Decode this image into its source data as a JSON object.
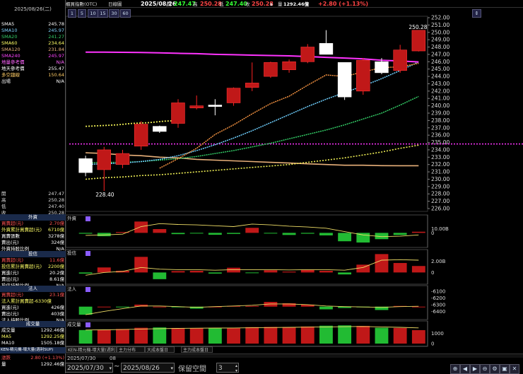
{
  "header": {
    "index_name": "櫃買指數(OTC)",
    "period": "日線圖",
    "date": "2025/08/26",
    "open_label": "開",
    "open": "247.47",
    "high_label": "高",
    "high": "250.28",
    "low_label": "低",
    "low": "247.40",
    "close_label": "收",
    "close": "250.28",
    "close_mark": "s",
    "volume_label": "量",
    "volume": "1292.46億",
    "change": "+2.80 (+1.13%)"
  },
  "toolbar": {
    "periods": [
      "1",
      "5",
      "10",
      "15",
      "30",
      "60"
    ]
  },
  "left": {
    "date": "2025/08/26(二)",
    "ma_rows": [
      {
        "k": "SMA5",
        "v": "245.78",
        "c": "#ffffff"
      },
      {
        "k": "SMA10",
        "v": "245.97",
        "c": "#7fd4ff"
      },
      {
        "k": "SMA20",
        "v": "241.27",
        "c": "#33cc66"
      },
      {
        "k": "SMA60",
        "v": "234.64",
        "c": "#ffff66"
      },
      {
        "k": "SMA120",
        "v": "231.84",
        "c": "#e8b07a"
      },
      {
        "k": "SMA240",
        "v": "245.97",
        "c": "#ff44ff"
      },
      {
        "k": "地量參考價",
        "v": "N/A",
        "c": "#ff66ff"
      },
      {
        "k": "地天參考價",
        "v": "255.47",
        "c": "#ffffff"
      },
      {
        "k": "多空趨線",
        "v": "150.64",
        "c": "#ffcc66"
      },
      {
        "k": "出場",
        "v": "N/A",
        "c": "#ffffff"
      }
    ],
    "ohlc_rows": [
      {
        "k": "開",
        "v": "247.47"
      },
      {
        "k": "高",
        "v": "250.28"
      },
      {
        "k": "低",
        "v": "247.40"
      },
      {
        "k": "收",
        "v": "250.28"
      }
    ],
    "foreign_title": "外資",
    "foreign_rows": [
      {
        "k": "買賣超(元)",
        "v": "2.70億",
        "c": "#ff5555"
      },
      {
        "k": "外資累計買賣超(元)",
        "v": "6710億",
        "c": "#ffff66"
      },
      {
        "k": "買賣張數",
        "v": "3278億",
        "c": "#ffffff"
      },
      {
        "k": "賣出(元)",
        "v": "324億",
        "c": "#ffffff"
      },
      {
        "k": "外資持股比例",
        "v": "N/A",
        "c": "#ffffff"
      }
    ],
    "trust_title": "投信",
    "trust_rows": [
      {
        "k": "買賣超(元)",
        "v": "11.6億",
        "c": "#ff5555"
      },
      {
        "k": "投信累計買賣超(元)",
        "v": "2200億",
        "c": "#ffff66"
      },
      {
        "k": "買進(元)",
        "v": "20.2億",
        "c": "#ffffff"
      },
      {
        "k": "賣出(元)",
        "v": "8.61億",
        "c": "#ffffff"
      },
      {
        "k": "投信持股比例",
        "v": "N/A",
        "c": "#ffffff"
      }
    ],
    "inst_title": "法人",
    "inst_rows": [
      {
        "k": "買賣超(元)",
        "v": "23.1億",
        "c": "#ff5555"
      },
      {
        "k": "法人累計買賣超-6330億",
        "v": "",
        "c": "#ffff66"
      },
      {
        "k": "買進(元)",
        "v": "426億",
        "c": "#ffffff"
      },
      {
        "k": "賣出(元)",
        "v": "403億",
        "c": "#ffffff"
      },
      {
        "k": "法人持股比例",
        "v": "N/A",
        "c": "#ffffff"
      }
    ],
    "vol_title": "成交量",
    "vol_rows": [
      {
        "k": "成交量",
        "v": "1292.46億",
        "c": "#ffffff"
      },
      {
        "k": "MA5",
        "v": "1292.25億",
        "c": "#ffff66"
      },
      {
        "k": "MA10",
        "v": "1505.18億",
        "c": "#ffffff"
      }
    ],
    "bottom_title": "KEN-精元機-壞大量(週利SUP)",
    "bottom_rows": [
      {
        "k": "漲跌",
        "v": "2.80 (+1.13%)",
        "c": "#ff5555"
      },
      {
        "k": "量",
        "v": "1292.46億",
        "c": "#ffffff"
      }
    ]
  },
  "bottom": {
    "tabs": [
      "KEN-精元機-壞大量(週利SUP)",
      "主力分布",
      "大成本盤日",
      "主力成本盤日"
    ],
    "start_date": "2025/07/30",
    "start_cursor_label": "08",
    "tilde": "~",
    "end_date": "2025/08/26",
    "keep_label": "保留空間",
    "keep_value": "3"
  },
  "panels": {
    "foreign": "外資",
    "trust": "投信",
    "inst": "法人",
    "volume": "成交量"
  },
  "annotations": {
    "high_marker": "250.28",
    "low_marker": "228.40"
  },
  "colors": {
    "up": "#c01818",
    "down": "#ffffff",
    "sma5": "#ffffff",
    "sma10": "#6fd0ff",
    "sma20": "#33cc66",
    "sma60": "#eeee55",
    "sma120": "#e8b07a",
    "sma240": "#ff33ff"
  },
  "chart_data": {
    "type": "candlestick",
    "price_axis": {
      "min": 226.0,
      "max": 252.0,
      "ticks": [
        "252.00",
        "251.00",
        "250.00",
        "249.00",
        "248.00",
        "247.00",
        "246.00",
        "245.00",
        "244.00",
        "243.00",
        "242.00",
        "241.00",
        "240.00",
        "239.00",
        "238.00",
        "237.00",
        "236.00",
        "235.00",
        "234.00",
        "233.00",
        "232.00",
        "231.00",
        "230.00",
        "229.00",
        "228.00",
        "227.00",
        "226.00"
      ]
    },
    "candles": [
      {
        "o": 232.8,
        "h": 233.2,
        "l": 230.4,
        "c": 230.9
      },
      {
        "o": 231.3,
        "h": 234.4,
        "l": 228.4,
        "c": 234.0
      },
      {
        "o": 232.0,
        "h": 234.0,
        "l": 231.5,
        "c": 233.5
      },
      {
        "o": 234.5,
        "h": 237.9,
        "l": 234.0,
        "c": 237.5
      },
      {
        "o": 237.2,
        "h": 237.3,
        "l": 236.3,
        "c": 236.5
      },
      {
        "o": 237.6,
        "h": 240.9,
        "l": 237.0,
        "c": 240.4
      },
      {
        "o": 239.7,
        "h": 241.4,
        "l": 239.5,
        "c": 240.0
      },
      {
        "o": 240.1,
        "h": 240.9,
        "l": 238.7,
        "c": 239.9
      },
      {
        "o": 240.4,
        "h": 242.5,
        "l": 240.0,
        "c": 242.4
      },
      {
        "o": 242.5,
        "h": 245.9,
        "l": 242.0,
        "c": 243.1
      },
      {
        "o": 244.0,
        "h": 246.0,
        "l": 243.8,
        "c": 245.9
      },
      {
        "o": 244.9,
        "h": 246.3,
        "l": 244.5,
        "c": 246.0
      },
      {
        "o": 246.0,
        "h": 248.4,
        "l": 245.8,
        "c": 248.0
      },
      {
        "o": 248.5,
        "h": 250.3,
        "l": 247.0,
        "c": 247.0
      },
      {
        "o": 245.9,
        "h": 245.9,
        "l": 240.8,
        "c": 241.2
      },
      {
        "o": 242.0,
        "h": 246.5,
        "l": 241.5,
        "c": 246.2
      },
      {
        "o": 246.0,
        "h": 246.5,
        "l": 244.3,
        "c": 244.5
      },
      {
        "o": 244.8,
        "h": 248.3,
        "l": 244.5,
        "c": 247.6
      },
      {
        "o": 247.47,
        "h": 250.28,
        "l": 247.4,
        "c": 250.28
      }
    ],
    "sma5": [
      null,
      null,
      null,
      null,
      231.5,
      232.8,
      234.2,
      236.1,
      237.4,
      238.9,
      240.3,
      241.3,
      242.8,
      244.2,
      244.0,
      244.6,
      245.2,
      245.3,
      245.78
    ],
    "sma10": [
      232.0,
      232.1,
      232.2,
      232.4,
      232.7,
      233.2,
      233.9,
      234.7,
      235.6,
      236.6,
      237.7,
      238.8,
      239.9,
      240.9,
      241.8,
      242.7,
      243.7,
      244.8,
      245.97
    ],
    "sma20": [
      232.2,
      232.3,
      232.3,
      232.4,
      232.6,
      232.8,
      233.1,
      233.5,
      233.9,
      234.4,
      234.9,
      235.5,
      236.1,
      236.7,
      237.4,
      238.2,
      239.0,
      240.1,
      241.27
    ],
    "sma60": [
      230.0,
      230.2,
      230.3,
      230.5,
      230.6,
      230.8,
      231.0,
      231.2,
      231.4,
      231.6,
      231.8,
      232.0,
      232.3,
      232.6,
      232.9,
      233.3,
      233.7,
      234.2,
      234.64
    ],
    "sma120": [
      233.6,
      233.5,
      233.3,
      233.2,
      233.0,
      232.9,
      232.7,
      232.6,
      232.5,
      232.4,
      232.3,
      232.2,
      232.1,
      232.0,
      231.9,
      231.9,
      231.85,
      231.84,
      231.84
    ],
    "sma240": [
      247.3,
      247.3,
      247.28,
      247.25,
      247.2,
      247.15,
      247.1,
      247.0,
      246.95,
      246.9,
      246.85,
      246.8,
      246.7,
      246.6,
      246.5,
      246.4,
      246.2,
      246.1,
      245.97
    ],
    "sma5_tail": [
      237.2,
      237.3,
      237.4,
      237.6,
      237.7,
      237.9,
      238.0
    ],
    "reference_line": 234.8,
    "foreign_net": [
      -200,
      -800,
      200,
      2700,
      900,
      -300,
      -150,
      -450,
      -250,
      1200,
      -150,
      -500,
      -200,
      -600,
      -2000,
      -2300,
      -1500,
      -500,
      270
    ],
    "foreign_axis": {
      "ticks": [
        "10.00B",
        "0"
      ]
    },
    "trust_net": [
      -200,
      900,
      300,
      2800,
      -1200,
      250,
      300,
      -200,
      850,
      -100,
      400,
      150,
      450,
      300,
      -350,
      1400,
      3300,
      1700,
      1160
    ],
    "trust_axis": {
      "ticks": [
        "2.00B",
        "0"
      ]
    },
    "inst_net": [
      -6450,
      -6330,
      -6340,
      -6300,
      -6330,
      -6340,
      -6360,
      -6330,
      -6320,
      -6320,
      -6260,
      -6280,
      -6300,
      -6370,
      -6350,
      -6340,
      -6380,
      -6320,
      -6330
    ],
    "inst_axis": {
      "ticks": [
        "-6100",
        "-6200",
        "-6300",
        "-6400"
      ]
    },
    "volume": [
      1300,
      1350,
      1400,
      1520,
      1550,
      1500,
      1460,
      1480,
      1510,
      1580,
      1600,
      1580,
      1640,
      1720,
      1750,
      1700,
      1520,
      1500,
      1292
    ],
    "volume_axis": {
      "ticks": [
        "1000",
        "0"
      ]
    }
  }
}
